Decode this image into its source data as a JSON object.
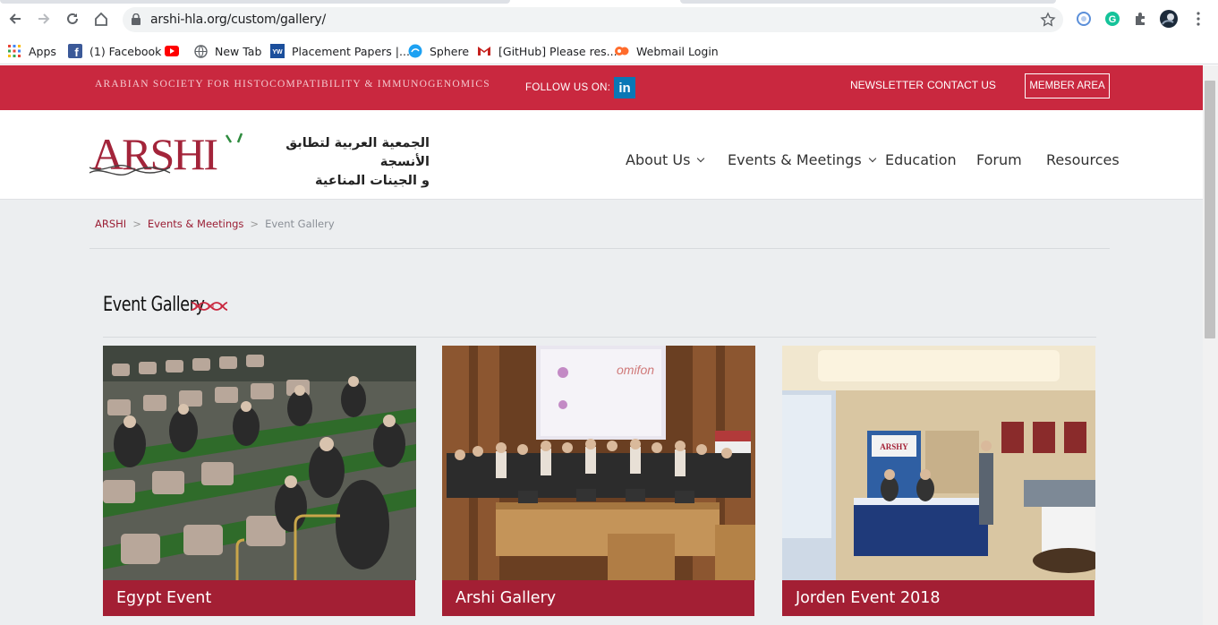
{
  "browser": {
    "url": "arshi-hla.org/custom/gallery/",
    "bookmarks": [
      {
        "label": "Apps",
        "icon": "apps-grid-icon"
      },
      {
        "label": "(1) Facebook",
        "icon": "facebook-icon"
      },
      {
        "label": "",
        "icon": "youtube-icon"
      },
      {
        "label": "New Tab",
        "icon": "globe-icon"
      },
      {
        "label": "Placement Papers |...",
        "icon": "yw-icon"
      },
      {
        "label": "Sphere",
        "icon": "sphere-icon"
      },
      {
        "label": "[GitHub] Please res...",
        "icon": "gmail-icon"
      },
      {
        "label": "Webmail Login",
        "icon": "cpanel-icon"
      }
    ]
  },
  "topbar": {
    "org_name": "ARABIAN SOCIETY FOR HISTOCOMPATIBILITY & IMMUNOGENOMICS",
    "follow_label": "FOLLOW US ON:",
    "linkedin_label": "in",
    "newsletter": "NEWSLETTER",
    "contact": "CONTACT US",
    "member_area": "MEMBER AREA"
  },
  "header": {
    "logo_text": "ARSHI",
    "arabic_line1": "الجمعية العربية لتطابق الأنسجة",
    "arabic_line2": "و الجينات المناعية",
    "nav": [
      "About Us",
      "Events & Meetings",
      "Education",
      "Forum",
      "Resources"
    ]
  },
  "breadcrumb": {
    "home": "ARSHI",
    "parent": "Events & Meetings",
    "current": "Event Gallery",
    "separator": ">"
  },
  "gallery": {
    "title": "Event Gallery",
    "items": [
      {
        "caption": "Egypt Event"
      },
      {
        "caption": "Arshi Gallery"
      },
      {
        "caption": "Jorden Event 2018"
      }
    ]
  },
  "colors": {
    "brand_red": "#c9283f",
    "caption_red": "#a31f34",
    "logo_green": "#2e8b3e"
  }
}
